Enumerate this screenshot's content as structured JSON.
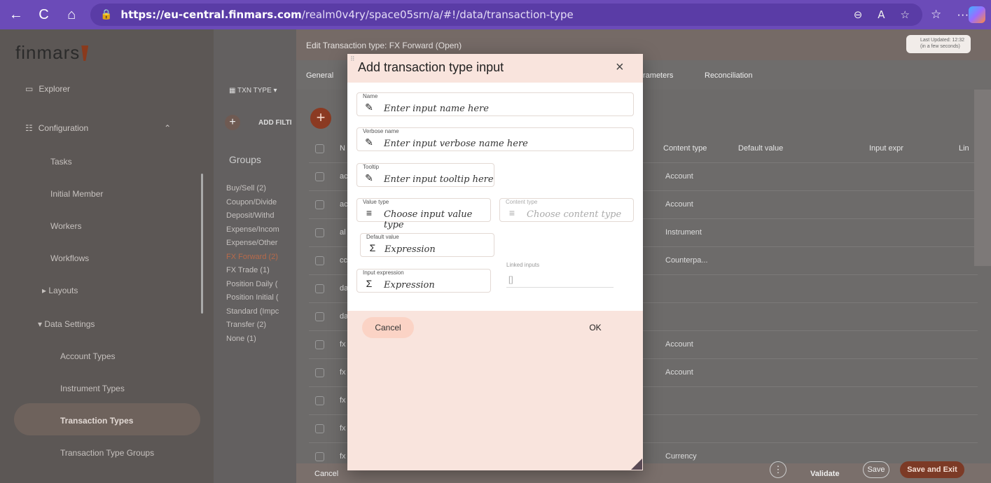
{
  "browser": {
    "url_host": "https://eu-central.finmars.com",
    "url_rest": "/realm0v4ry/space05srn/a/#!/data/transaction-type",
    "back_icon": "←",
    "reload_icon": "C",
    "home_icon": "⌂",
    "lock_icon": "🔒",
    "zoom_icon": "🔍",
    "read_icon": "A⁾",
    "fav_icon": "☆",
    "favs_icon": "✰",
    "more_icon": "···"
  },
  "sidebar": {
    "logo": "finmars",
    "explorer": "Explorer",
    "configuration": "Configuration",
    "items": [
      "Tasks",
      "Initial Member",
      "Workers",
      "Workflows"
    ],
    "layouts": "Layouts",
    "data_settings": "Data Settings",
    "sub_items": [
      "Account Types",
      "Instrument Types",
      "Transaction Types",
      "Transaction Type Groups"
    ]
  },
  "groups": {
    "txn_type": "TXN TYPE",
    "add_filter": "ADD FILTI",
    "title": "Groups",
    "list": [
      "Buy/Sell (2)",
      "Coupon/Divide",
      "Deposit/Withd",
      "Expense/Incom",
      "Expense/Other",
      "FX Forward (2)",
      "FX Trade (1)",
      "Position Daily (",
      "Position Initial (",
      "Standard (Impc",
      "Transfer (2)",
      "None (1)"
    ]
  },
  "main": {
    "edit_title": "Edit Transaction type: FX Forward (Open)",
    "last_updated": "Last Updated: 12:32",
    "last_updated_sub": "(in a few seconds)",
    "tab_general": "General",
    "tab_parameters": "rameters",
    "tab_reconciliation": "Reconciliation",
    "col_n": "N",
    "col_content_type": "Content type",
    "col_default_value": "Default value",
    "col_input_expr": "Input expr",
    "col_lin": "Lin",
    "row_names": [
      "ac",
      "ac",
      "al",
      "cc",
      "da",
      "da",
      "fx",
      "fx",
      "fx",
      "fx",
      "fx"
    ],
    "row_content": [
      "Account",
      "Account",
      "Instrument",
      "Counterpa...",
      "",
      "",
      "Account",
      "Account",
      "",
      "",
      "Currency"
    ],
    "add_icon": "+",
    "bottom_cancel": "Cancel",
    "bottom_more": "⋮",
    "bottom_validate": "Validate",
    "bottom_save": "Save",
    "bottom_save_exit": "Save and Exit"
  },
  "modal": {
    "title": "Add transaction type input",
    "close_icon": "×",
    "drag_icon": "⠿",
    "name_label": "Name",
    "name_placeholder": "Enter input name here",
    "verbose_label": "Verbose name",
    "verbose_placeholder": "Enter input verbose name here",
    "tooltip_label": "Tooltip",
    "tooltip_placeholder": "Enter input tooltip here",
    "value_type_label": "Value type",
    "value_type_placeholder": "Choose input value type",
    "content_type_label": "Content type",
    "content_type_placeholder": "Choose content type",
    "default_label": "Default value",
    "default_placeholder": "Expression",
    "input_expr_label": "Input expression",
    "input_expr_placeholder": "Expression",
    "linked_label": "Linked inputs",
    "linked_value": "[]",
    "cancel": "Cancel",
    "ok": "OK",
    "pencil_icon": "✎",
    "list_icon": "≡",
    "sigma_icon": "Σ"
  },
  "colors": {
    "accent": "#8b3a22",
    "browser": "#6b4bb8",
    "modal_footer": "#f9e4dd"
  }
}
